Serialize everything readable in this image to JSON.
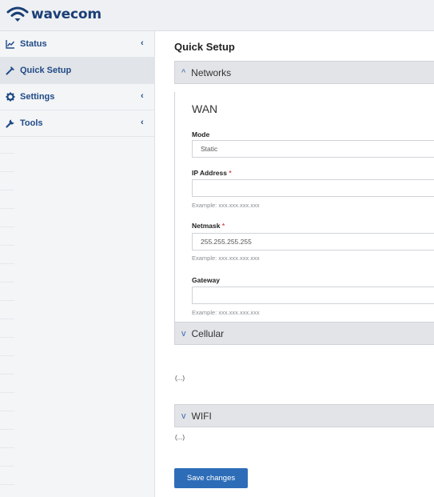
{
  "app": {
    "brand": "wavecom",
    "brand_color": "#1b3f75"
  },
  "sidebar": {
    "items": [
      {
        "label": "Status",
        "icon": "chart-line-icon",
        "has_chevron": true
      },
      {
        "label": "Quick Setup",
        "icon": "magic-wand-icon",
        "has_chevron": false,
        "active": true
      },
      {
        "label": "Settings",
        "icon": "gear-icon",
        "has_chevron": true
      },
      {
        "label": "Tools",
        "icon": "wrench-icon",
        "has_chevron": true
      }
    ],
    "chevron": "‹"
  },
  "main": {
    "title": "Quick Setup",
    "panels": [
      {
        "label": "Networks",
        "chevron": "^",
        "expanded": true
      },
      {
        "label": "Cellular",
        "chevron": "v",
        "expanded": false
      },
      {
        "label": "WIFI",
        "chevron": "v",
        "expanded": false
      }
    ],
    "wan": {
      "title": "WAN",
      "mode_label": "Mode",
      "mode_value": "Static",
      "ip_label": "IP Address",
      "ip_value": "",
      "ip_hint": "Example: xxx.xxx.xxx.xxx",
      "netmask_label": "Netmask",
      "netmask_value": "255.255.255.255",
      "netmask_hint": "Example: xxx.xxx.xxx.xxx",
      "gateway_label": "Gateway",
      "gateway_value": "",
      "gateway_hint": "Example: xxx.xxx.xxx.xxx",
      "required_mark": "*",
      "ellipsis": "(...)"
    },
    "cellular_ellipsis": "(...)",
    "wifi_ellipsis": "(...)",
    "save_label": "Save changes"
  },
  "colors": {
    "accent": "#2d6db8",
    "nav_text": "#1f4a86",
    "required": "#d9534f"
  }
}
